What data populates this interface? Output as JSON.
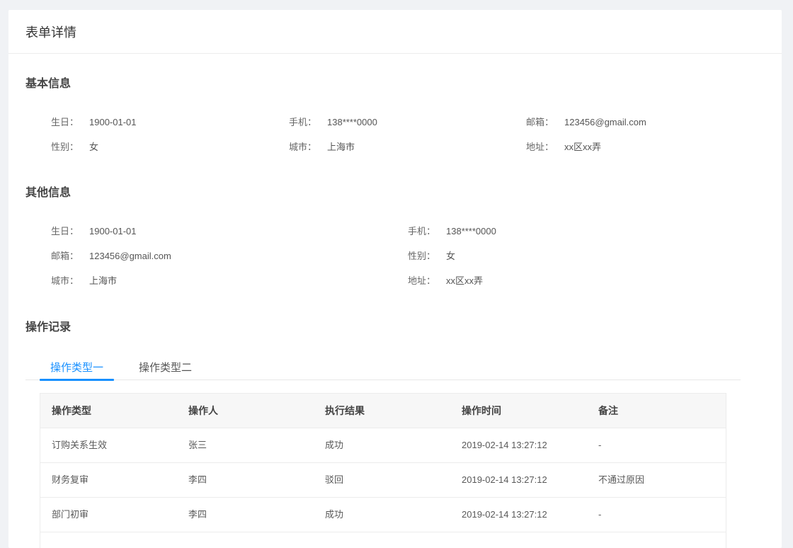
{
  "page": {
    "title": "表单详情"
  },
  "basic": {
    "title": "基本信息",
    "rows": [
      [
        {
          "label": "生日：",
          "value": "1900-01-01"
        },
        {
          "label": "手机：",
          "value": "138****0000"
        },
        {
          "label": "邮箱：",
          "value": "123456@gmail.com"
        }
      ],
      [
        {
          "label": "性别：",
          "value": "女"
        },
        {
          "label": "城市：",
          "value": "上海市"
        },
        {
          "label": "地址：",
          "value": "xx区xx弄"
        }
      ]
    ]
  },
  "other": {
    "title": "其他信息",
    "rows": [
      [
        {
          "label": "生日：",
          "value": "1900-01-01"
        },
        {
          "label": "手机：",
          "value": "138****0000"
        }
      ],
      [
        {
          "label": "邮箱：",
          "value": "123456@gmail.com"
        },
        {
          "label": "性别：",
          "value": "女"
        }
      ],
      [
        {
          "label": "城市：",
          "value": "上海市"
        },
        {
          "label": "地址：",
          "value": "xx区xx弄"
        }
      ]
    ]
  },
  "records": {
    "title": "操作记录",
    "tabs": [
      {
        "label": "操作类型一",
        "active": true
      },
      {
        "label": "操作类型二",
        "active": false
      }
    ],
    "columns": [
      "操作类型",
      "操作人",
      "执行结果",
      "操作时间",
      "备注"
    ],
    "rows": [
      [
        "订购关系生效",
        "张三",
        "成功",
        "2019-02-14 13:27:12",
        "-"
      ],
      [
        "财务复审",
        "李四",
        "驳回",
        "2019-02-14 13:27:12",
        "不通过原因"
      ],
      [
        "部门初审",
        "李四",
        "成功",
        "2019-02-14 13:27:12",
        "-"
      ]
    ]
  },
  "colors": {
    "accent": "#1890ff"
  }
}
